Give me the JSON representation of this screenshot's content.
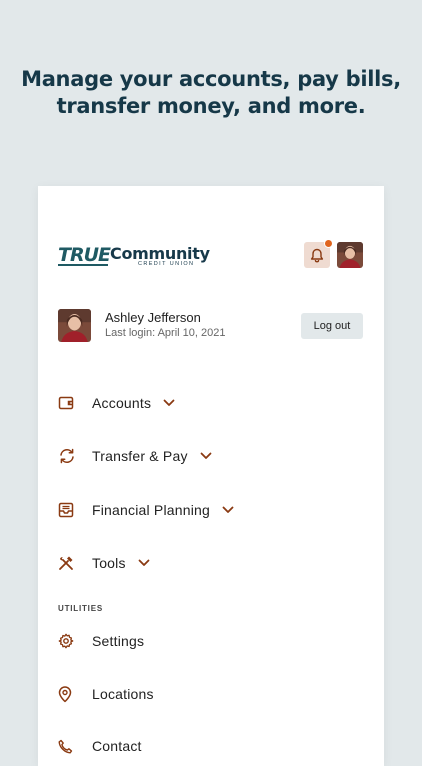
{
  "headline": {
    "line1": "Manage your accounts, pay bills,",
    "line2": "transfer money, and more."
  },
  "brand": {
    "logo_word1": "TRUE",
    "logo_word2": "Community",
    "logo_sub": "CREDIT UNION",
    "primary_color": "#17394a",
    "accent_color": "#8a3a12"
  },
  "header": {
    "notification_icon": "bell-icon",
    "has_notification": true
  },
  "user": {
    "name": "Ashley Jefferson",
    "last_login": "Last login: April 10, 2021",
    "logout_label": "Log out"
  },
  "menu": {
    "items": [
      {
        "label": "Accounts",
        "icon": "wallet-icon"
      },
      {
        "label": "Transfer & Pay",
        "icon": "transfer-icon"
      },
      {
        "label": "Financial Planning",
        "icon": "inbox-icon"
      },
      {
        "label": "Tools",
        "icon": "tools-icon"
      }
    ]
  },
  "utilities": {
    "section_label": "UTILITIES",
    "items": [
      {
        "label": "Settings",
        "icon": "gear-icon"
      },
      {
        "label": "Locations",
        "icon": "location-pin-icon"
      },
      {
        "label": "Contact",
        "icon": "phone-icon"
      }
    ]
  }
}
